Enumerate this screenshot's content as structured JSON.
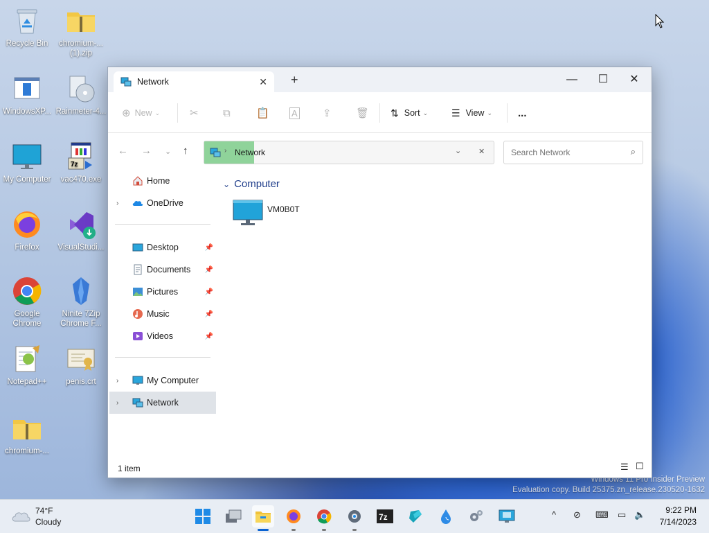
{
  "desktop": {
    "icons": [
      {
        "label": "Recycle Bin",
        "icon": "recycle-bin-icon"
      },
      {
        "label": "chromium-...\n(1).zip",
        "icon": "zip-folder-icon"
      },
      {
        "label": "WindowsXP...",
        "icon": "window-app-icon"
      },
      {
        "label": "Rainmeter-4...",
        "icon": "installer-disc-icon"
      },
      {
        "label": "My Computer",
        "icon": "monitor-icon"
      },
      {
        "label": "vac470.exe",
        "icon": "exe-installer-icon"
      },
      {
        "label": "Firefox",
        "icon": "firefox-icon"
      },
      {
        "label": "VisualStudi...",
        "icon": "visual-studio-installer-icon"
      },
      {
        "label": "Google\nChrome",
        "icon": "chrome-icon"
      },
      {
        "label": "Ninite 7Zip\nChrome F...",
        "icon": "ninite-icon"
      },
      {
        "label": "Notepad++",
        "icon": "notepadpp-icon"
      },
      {
        "label": "penis.crt",
        "icon": "certificate-icon"
      },
      {
        "label": "chromium-...",
        "icon": "zip-folder-icon"
      }
    ],
    "watermark_line1": "Windows 11 Pro Insider Preview",
    "watermark_line2": "Evaluation copy. Build 25375.zn_release.230520-1632"
  },
  "explorer": {
    "tab_title": "Network",
    "toolbar": {
      "new": "New",
      "sort": "Sort",
      "view": "View",
      "more": "..."
    },
    "address": {
      "crumb": "Network"
    },
    "search": {
      "placeholder": "Search Network"
    },
    "nav": {
      "home": "Home",
      "onedrive": "OneDrive",
      "quick_access": [
        {
          "label": "Desktop"
        },
        {
          "label": "Documents"
        },
        {
          "label": "Pictures"
        },
        {
          "label": "Music"
        },
        {
          "label": "Videos"
        }
      ],
      "my_computer": "My Computer",
      "network": "Network"
    },
    "content": {
      "group": "Computer",
      "items": [
        {
          "name": "VM0B0T"
        }
      ]
    },
    "status": "1 item"
  },
  "taskbar": {
    "weather_temp": "74°F",
    "weather_desc": "Cloudy",
    "time": "9:22 PM",
    "date": "7/14/2023"
  },
  "colors": {
    "accent": "#0a63d2",
    "address_highlight": "#8fd39a",
    "group_header": "#1f3d8a"
  }
}
